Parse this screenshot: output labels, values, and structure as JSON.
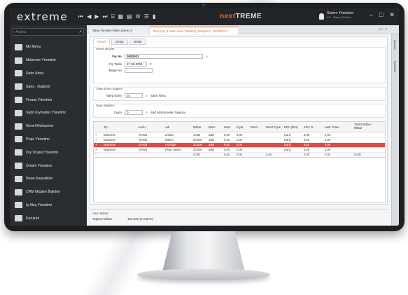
{
  "app": {
    "logo": "extreme",
    "toolbar_icons": [
      "⏮",
      "◀",
      "▶",
      "⏭",
      "⌸",
      "▦",
      "▤",
      "⚙",
      "☰",
      "▮"
    ],
    "brand_primary": "next",
    "brand_secondary": "TREME",
    "user_name": "Sistem Yöneticisi",
    "user_role": "AP · Sistem Görevi",
    "window_controls": [
      "–",
      "□",
      "✕"
    ]
  },
  "colors": {
    "brand_orange": "#f36f21",
    "selected_row": "#e04a46",
    "dark_bg": "#2a2e33"
  },
  "sidebar": {
    "search_placeholder": "Arama",
    "items": [
      {
        "label": "My Menu",
        "icon": "star-menu-icon"
      },
      {
        "label": "Malzeme Yönetimi",
        "icon": "material-icon"
      },
      {
        "label": "Satın Alma",
        "icon": "cart-icon"
      },
      {
        "label": "Satış - Dağıtım",
        "icon": "distribution-icon"
      },
      {
        "label": "Finans Yönetimi",
        "icon": "finance-icon"
      },
      {
        "label": "Sabit Kıymetler Yönetimi",
        "icon": "fixed-asset-icon"
      },
      {
        "label": "Genel Muhasebe",
        "icon": "ledger-icon"
      },
      {
        "label": "Proje Yönetimi",
        "icon": "project-icon"
      },
      {
        "label": "Dış Ticaret Yönetimi",
        "icon": "globe-icon"
      },
      {
        "label": "Üretim Yönetimi",
        "icon": "factory-icon"
      },
      {
        "label": "İnsan Kaynakları",
        "icon": "hr-icon"
      },
      {
        "label": "CRM Müşteri İlişkileri",
        "icon": "crm-icon"
      },
      {
        "label": "İş Akış Yönetimi",
        "icon": "workflow-icon"
      },
      {
        "label": "Kurulum",
        "icon": "gear-icon"
      }
    ]
  },
  "tabs": [
    {
      "label": "Talep Yönetimi Fişleri Listesi  ✕"
    },
    {
      "label": "Talep Fişi  (1-Satın Alma Talepleri) (Oluşturul) - 0000003  ✕"
    }
  ],
  "right_tabs": [
    "İşlemler",
    "Özellikler"
  ],
  "form": {
    "subtabs": [
      "Genel",
      "Detay",
      "Notlar"
    ],
    "group_general": "Genel Bilgiler",
    "fis_no_label": "Fiş No",
    "fis_no_value": "0000003",
    "fis_tarihi_label": "Fiş Tarihi",
    "fis_tarihi_value": "17.06.2008",
    "belge_no_label": "Belge No",
    "belge_no_value": "",
    "group_talep": "Talep Eden Bilgileri",
    "talep_eden_label": "Talep Eden",
    "talep_eden_value": "01",
    "talep_eden_desc": "Satın Alma",
    "group_depo": "Depo Bilgileri",
    "depo_label": "Depo",
    "depo_value": "0",
    "depo_desc": "Sarf Malzemeleri Deposu"
  },
  "grid": {
    "columns": [
      "Tip",
      "Kodu",
      "Adı",
      "Miktar",
      "Birim",
      "Oran",
      "Fiyat",
      "Döviz",
      "Döviz Fiyat",
      "KDV (D/H)",
      "KDV %",
      "Satır Tutarı",
      "Teslim Edilen Miktar"
    ],
    "rows": [
      {
        "tip": "Malzeme",
        "kodu": "SF001",
        "adi": "Zımba",
        "miktar": "3,000",
        "birim": "adet",
        "oran": "0,00",
        "fiyat": "0,00",
        "doviz": "",
        "doviz_fiyat": "",
        "kdv_dh": "Hariç",
        "kdv": "8,00",
        "satir_tutari": "0,00",
        "teslim": ""
      },
      {
        "tip": "Malzeme",
        "kodu": "SF002",
        "adi": "Kalem",
        "miktar": "60,000",
        "birim": "adet",
        "oran": "0,00",
        "fiyat": "0,00",
        "doviz": "",
        "doviz_fiyat": "",
        "kdv_dh": "Hariç",
        "kdv": "8,00",
        "satir_tutari": "0,00",
        "teslim": ""
      },
      {
        "tip": "Malzeme",
        "kodu": "SF003",
        "adi": "A4 kağıt",
        "miktar": "30,000",
        "birim": "adet",
        "oran": "0,00",
        "fiyat": "0,00",
        "doviz": "",
        "doviz_fiyat": "",
        "kdv_dh": "Hariç",
        "kdv": "8,00",
        "satir_tutari": "0,00",
        "teslim": ""
      },
      {
        "tip": "Malzeme",
        "kodu": "SF005",
        "adi": "Proje Dosya",
        "miktar": "30,000",
        "birim": "adet",
        "oran": "0,00",
        "fiyat": "0,00",
        "doviz": "",
        "doviz_fiyat": "",
        "kdv_dh": "Hariç",
        "kdv": "8,00",
        "satir_tutari": "0,00",
        "teslim": ""
      }
    ],
    "totals": {
      "miktar": "0,000",
      "oran": "0,00",
      "fiyat": "0,00",
      "doviz_fiyat": "0,00",
      "kdv": "0,00",
      "satir_tutari": "0,00",
      "teslim": "0,000"
    },
    "selected_row": 2
  },
  "summary": {
    "title": "Satır Miktar",
    "label": "Toplam Miktar",
    "value": "153,000  (4 Kalem)"
  }
}
